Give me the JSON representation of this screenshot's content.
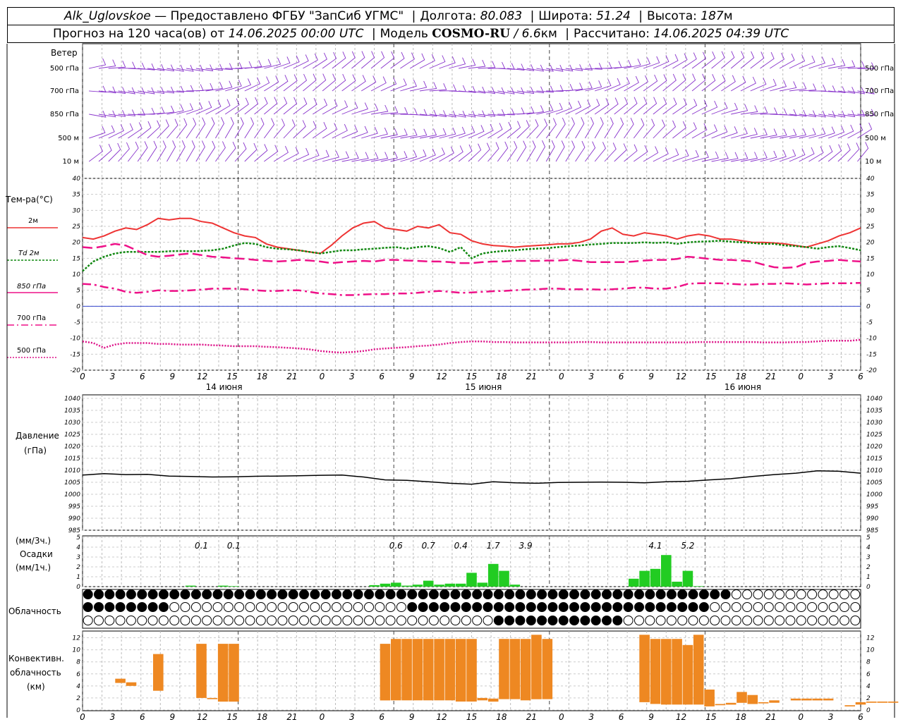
{
  "header": {
    "station": "Alk_Uglovskoe",
    "provider": "— Предоставлено ФГБУ \"ЗапСиб УГМС\"",
    "lon_label": "Долгота:",
    "lon_value": "80.083",
    "lat_label": "Широта:",
    "lat_value": "51.24",
    "alt_label": "Высота:",
    "alt_value": "187",
    "alt_unit": "м",
    "forecast_prefix": "Прогноз на 120 часа(ов) от",
    "forecast_time": "14.06.2025 00:00 UTC",
    "model_label": "Модель",
    "model_name": "COSMO-RU",
    "model_res": "/ 6.6",
    "model_res_unit": "км",
    "calc_label": "Рассчитано:",
    "calc_time": "14.06.2025 04:39 UTC"
  },
  "labels": {
    "wind": "Ветер",
    "wind_levels": [
      "500 гПа",
      "700 гПа",
      "850 гПа",
      "500 м",
      "10 м"
    ],
    "temp": "Тем-ра(°C)",
    "temp_legend": [
      "2м",
      "Td 2м",
      "850 гПа",
      "700 гПа",
      "500 гПа"
    ],
    "pressure": [
      "Давление",
      "(гПа)"
    ],
    "precip": [
      "(мм/3ч.)",
      "Осадки",
      "(мм/1ч.)"
    ],
    "cloud": "Облачность",
    "conv": [
      "Конвективн.",
      "облачность",
      "(км)"
    ]
  },
  "colors": {
    "t2m": "#ee3333",
    "td2m": "#118811",
    "t850": "#ee1188",
    "t700": "#ee1188",
    "t500": "#dd1188",
    "wind": "#8833cc",
    "zero": "#3344cc",
    "pressure": "#000000",
    "precip": "#22cc22",
    "conv": "#ee8822"
  },
  "days": [
    "14 июня",
    "15 июня",
    "16 июня"
  ],
  "hour_ticks": [
    "0",
    "3",
    "6",
    "9",
    "12",
    "15",
    "18",
    "21",
    "0",
    "3",
    "6",
    "9",
    "12",
    "15",
    "18",
    "21",
    "0",
    "3",
    "6",
    "9",
    "12",
    "15",
    "18",
    "21",
    "0",
    "3",
    "6"
  ],
  "chart_data": [
    {
      "type": "line",
      "title": "Тем-ра(°C)",
      "x": [
        0,
        1,
        2,
        3,
        4,
        5,
        6,
        7,
        8,
        9,
        10,
        11,
        12,
        13,
        14,
        15,
        16,
        17,
        18,
        19,
        20,
        21,
        22,
        23,
        24,
        25,
        26,
        27,
        28,
        29,
        30,
        31,
        32,
        33,
        34,
        35,
        36,
        37,
        38,
        39,
        40,
        41,
        42,
        43,
        44,
        45,
        46,
        47,
        48,
        49,
        50,
        51,
        52,
        53,
        54,
        55,
        56,
        57,
        58,
        59,
        60,
        61,
        62,
        63,
        64,
        65,
        66,
        67,
        68,
        69,
        70,
        71,
        72
      ],
      "ylim": [
        -20,
        40
      ],
      "series": [
        {
          "name": "2м",
          "values": [
            21.5,
            21,
            22,
            23.5,
            24.5,
            24,
            25.5,
            27.5,
            27,
            27.5,
            27.5,
            26.5,
            26,
            24.5,
            23,
            22,
            21.5,
            19.5,
            18.5,
            18,
            17.5,
            17,
            16.5,
            19,
            22,
            24.5,
            26,
            26.5,
            24.5,
            24,
            23.5,
            25,
            24.5,
            25.5,
            23,
            22.5,
            20.5,
            19.5,
            19,
            18.8,
            18.5,
            18.8,
            19,
            19.2,
            19.5,
            19.5,
            20,
            21,
            23.5,
            24.5,
            22.5,
            22,
            23,
            22.5,
            22,
            21,
            22,
            22.5,
            22,
            21,
            21,
            20.5,
            20,
            20,
            19.8,
            19.5,
            19,
            18.5,
            19.5,
            20.5,
            22,
            23,
            24.5
          ]
        },
        {
          "name": "Td 2м",
          "values": [
            11,
            14,
            15.5,
            16.5,
            17,
            17,
            17,
            17,
            17.2,
            17.3,
            17.2,
            17.3,
            17.5,
            18,
            19,
            19.8,
            19.5,
            18.5,
            18,
            17.8,
            17.5,
            17,
            16.5,
            17,
            17.5,
            17.5,
            17.8,
            18,
            18.3,
            18.5,
            18,
            18.5,
            18.8,
            18.2,
            17,
            18.5,
            15,
            16.5,
            17,
            17.3,
            17.5,
            17.8,
            18,
            18.2,
            18.5,
            18.8,
            19,
            19.3,
            19.5,
            19.8,
            19.8,
            19.8,
            20,
            19.8,
            20,
            19.5,
            20,
            20.2,
            20.3,
            20.5,
            20.2,
            20,
            19.8,
            19.5,
            19.5,
            19,
            18.8,
            18.5,
            18,
            18.5,
            18.8,
            18.2,
            17.5
          ]
        },
        {
          "name": "850 гПа",
          "values": [
            18.5,
            18.2,
            18.8,
            19.5,
            19,
            17.5,
            16,
            15.5,
            15.8,
            16.2,
            16.5,
            16,
            15.5,
            15.3,
            15,
            14.8,
            14.5,
            14.2,
            14,
            14.2,
            14.5,
            14.3,
            14,
            13.5,
            13.8,
            14,
            14.2,
            14,
            14.5,
            14.5,
            14.3,
            14.2,
            14,
            14,
            13.8,
            13.5,
            13.5,
            13.8,
            14,
            14,
            14.2,
            14.2,
            14.2,
            14.3,
            14.3,
            14.5,
            14.2,
            13.8,
            13.8,
            13.8,
            13.8,
            14,
            14.3,
            14.5,
            14.5,
            14.8,
            15.5,
            15.2,
            14.8,
            14.5,
            14.5,
            14.3,
            14,
            13,
            12.2,
            12,
            12.2,
            13.5,
            14,
            14.2,
            14.5,
            14.2,
            14
          ]
        },
        {
          "name": "700 гПа",
          "values": [
            7,
            6.8,
            6,
            5.5,
            4.5,
            4.2,
            4.5,
            5,
            4.8,
            4.8,
            5,
            5.2,
            5.5,
            5.5,
            5.5,
            5.3,
            5,
            4.8,
            4.8,
            5,
            5,
            4.5,
            4,
            3.8,
            3.5,
            3.5,
            3.7,
            3.8,
            3.8,
            4,
            4,
            4.2,
            4.5,
            4.8,
            4.5,
            4.2,
            4.3,
            4.5,
            4.7,
            4.8,
            5,
            5.2,
            5.3,
            5.5,
            5.5,
            5.3,
            5.3,
            5.3,
            5.2,
            5.3,
            5.5,
            5.8,
            5.8,
            5.5,
            5.5,
            6,
            7,
            7.2,
            7.2,
            7.2,
            7,
            6.8,
            6.8,
            7,
            7,
            7.2,
            7,
            6.8,
            7,
            7.2,
            7.2,
            7.2,
            7.3
          ]
        },
        {
          "name": "500 гПа",
          "values": [
            -11,
            -11.5,
            -13,
            -12,
            -11.5,
            -11.5,
            -11.5,
            -11.8,
            -11.8,
            -12,
            -12,
            -12,
            -12.2,
            -12.3,
            -12.5,
            -12.5,
            -12.5,
            -12.7,
            -12.8,
            -13,
            -13.2,
            -13.5,
            -14,
            -14.3,
            -14.5,
            -14.3,
            -14,
            -13.5,
            -13.2,
            -13,
            -12.8,
            -12.5,
            -12.3,
            -12,
            -11.5,
            -11.2,
            -11,
            -11,
            -11.2,
            -11.2,
            -11.3,
            -11.3,
            -11.3,
            -11.3,
            -11.3,
            -11.3,
            -11.2,
            -11.2,
            -11.3,
            -11.3,
            -11.3,
            -11.3,
            -11.3,
            -11.3,
            -11.3,
            -11.3,
            -11.3,
            -11.2,
            -11.2,
            -11.2,
            -11.2,
            -11.2,
            -11.2,
            -11.3,
            -11.3,
            -11.3,
            -11.2,
            -11.2,
            -11,
            -10.8,
            -10.8,
            -10.8,
            -10.5
          ]
        }
      ]
    },
    {
      "type": "line",
      "title": "Давление (гПа)",
      "ylim": [
        985,
        1040
      ],
      "x": [
        0,
        2,
        4,
        6,
        8,
        10,
        12,
        14,
        16,
        18,
        20,
        22,
        24,
        26,
        28,
        30,
        32,
        34,
        36,
        38,
        40,
        42,
        44,
        46,
        48,
        50,
        52,
        54,
        56,
        58,
        60,
        62,
        64,
        66,
        68,
        70,
        72
      ],
      "series": [
        {
          "name": "",
          "values": [
            1008,
            1008.6,
            1008.2,
            1008.3,
            1007.6,
            1007.4,
            1007.2,
            1007.3,
            1007.5,
            1007.6,
            1007.7,
            1007.9,
            1008,
            1007.2,
            1006,
            1005.8,
            1005.2,
            1004.6,
            1004.2,
            1005.2,
            1004.8,
            1004.6,
            1004.9,
            1005,
            1005.1,
            1005,
            1004.8,
            1005.2,
            1005.4,
            1006,
            1006.5,
            1007.4,
            1008.2,
            1008.8,
            1009.8,
            1009.6,
            1008.8
          ]
        }
      ]
    },
    {
      "type": "bar",
      "title": "Осадки (мм/1ч.)",
      "ylim": [
        0,
        5
      ],
      "x": [
        10,
        13,
        14,
        27,
        28,
        29,
        30,
        31,
        32,
        33,
        34,
        35,
        36,
        37,
        38,
        39,
        40,
        51,
        52,
        53,
        54,
        55,
        56,
        57
      ],
      "values": [
        0.1,
        0.1,
        0.05,
        0.15,
        0.3,
        0.4,
        0.1,
        0.2,
        0.6,
        0.2,
        0.3,
        0.3,
        1.4,
        0.4,
        2.3,
        1.6,
        0.2,
        0.8,
        1.6,
        1.8,
        3.2,
        0.5,
        1.6,
        0.05
      ],
      "totals_3h": [
        {
          "x": 11,
          "value": "0.1"
        },
        {
          "x": 14,
          "value": "0.1"
        },
        {
          "x": 29,
          "value": "0.6"
        },
        {
          "x": 32,
          "value": "0.7"
        },
        {
          "x": 35,
          "value": "0.4"
        },
        {
          "x": 38,
          "value": "1.7"
        },
        {
          "x": 41,
          "value": "3.9"
        },
        {
          "x": 53,
          "value": "4.1"
        },
        {
          "x": 56,
          "value": "5.2"
        }
      ]
    },
    {
      "type": "bar",
      "title": "Конвективн. облачность (км)",
      "ylim": [
        0,
        13
      ],
      "bars": [
        {
          "x": 3.5,
          "base": 4.5,
          "top": 5.2
        },
        {
          "x": 4.5,
          "base": 4,
          "top": 4.6
        },
        {
          "x": 7,
          "base": 3.2,
          "top": 9.3
        },
        {
          "x": 11,
          "base": 2,
          "top": 11
        },
        {
          "x": 12,
          "base": 1.8,
          "top": 2
        },
        {
          "x": 13,
          "base": 1.4,
          "top": 11
        },
        {
          "x": 14,
          "base": 1.4,
          "top": 11
        },
        {
          "x": 28,
          "base": 1.6,
          "top": 11
        },
        {
          "x": 29,
          "base": 1.6,
          "top": 11.8
        },
        {
          "x": 30,
          "base": 1.6,
          "top": 11.8
        },
        {
          "x": 31,
          "base": 1.6,
          "top": 11.8
        },
        {
          "x": 32,
          "base": 1.6,
          "top": 11.8
        },
        {
          "x": 33,
          "base": 1.6,
          "top": 11.8
        },
        {
          "x": 34,
          "base": 1.6,
          "top": 11.8
        },
        {
          "x": 35,
          "base": 1.4,
          "top": 11.8
        },
        {
          "x": 36,
          "base": 1.4,
          "top": 11.8
        },
        {
          "x": 37,
          "base": 1.6,
          "top": 2
        },
        {
          "x": 38,
          "base": 1.4,
          "top": 1.9
        },
        {
          "x": 39,
          "base": 1.8,
          "top": 11.8
        },
        {
          "x": 40,
          "base": 1.8,
          "top": 11.8
        },
        {
          "x": 41,
          "base": 1.6,
          "top": 11.8
        },
        {
          "x": 42,
          "base": 1.8,
          "top": 12.5
        },
        {
          "x": 43,
          "base": 1.8,
          "top": 11.8
        },
        {
          "x": 52,
          "base": 1.3,
          "top": 12.5
        },
        {
          "x": 53,
          "base": 1,
          "top": 11.8
        },
        {
          "x": 54,
          "base": 0.9,
          "top": 11.8
        },
        {
          "x": 55,
          "base": 0.9,
          "top": 11.8
        },
        {
          "x": 56,
          "base": 0.9,
          "top": 10.8
        },
        {
          "x": 57,
          "base": 0.9,
          "top": 12.5
        },
        {
          "x": 58,
          "base": 0.6,
          "top": 3.4
        },
        {
          "x": 59,
          "base": 0.8,
          "top": 1
        },
        {
          "x": 60,
          "base": 0.9,
          "top": 1.2
        },
        {
          "x": 61,
          "base": 1.2,
          "top": 3
        },
        {
          "x": 62,
          "base": 1,
          "top": 2.5
        },
        {
          "x": 63,
          "base": 1.1,
          "top": 1.3
        },
        {
          "x": 64,
          "base": 1.2,
          "top": 1.6
        },
        {
          "x": 66,
          "base": 1.6,
          "top": 1.9
        },
        {
          "x": 67,
          "base": 1.6,
          "top": 1.9
        },
        {
          "x": 68,
          "base": 1.6,
          "top": 1.9
        },
        {
          "x": 69,
          "base": 1.6,
          "top": 1.9
        },
        {
          "x": 71,
          "base": 0.6,
          "top": 0.8
        },
        {
          "x": 72,
          "base": 0.9,
          "top": 1.3
        },
        {
          "x": 73,
          "base": 1.2,
          "top": 1.4
        },
        {
          "x": 74,
          "base": 1.2,
          "top": 1.4
        },
        {
          "x": 75,
          "base": 1.2,
          "top": 1.4
        }
      ]
    }
  ]
}
